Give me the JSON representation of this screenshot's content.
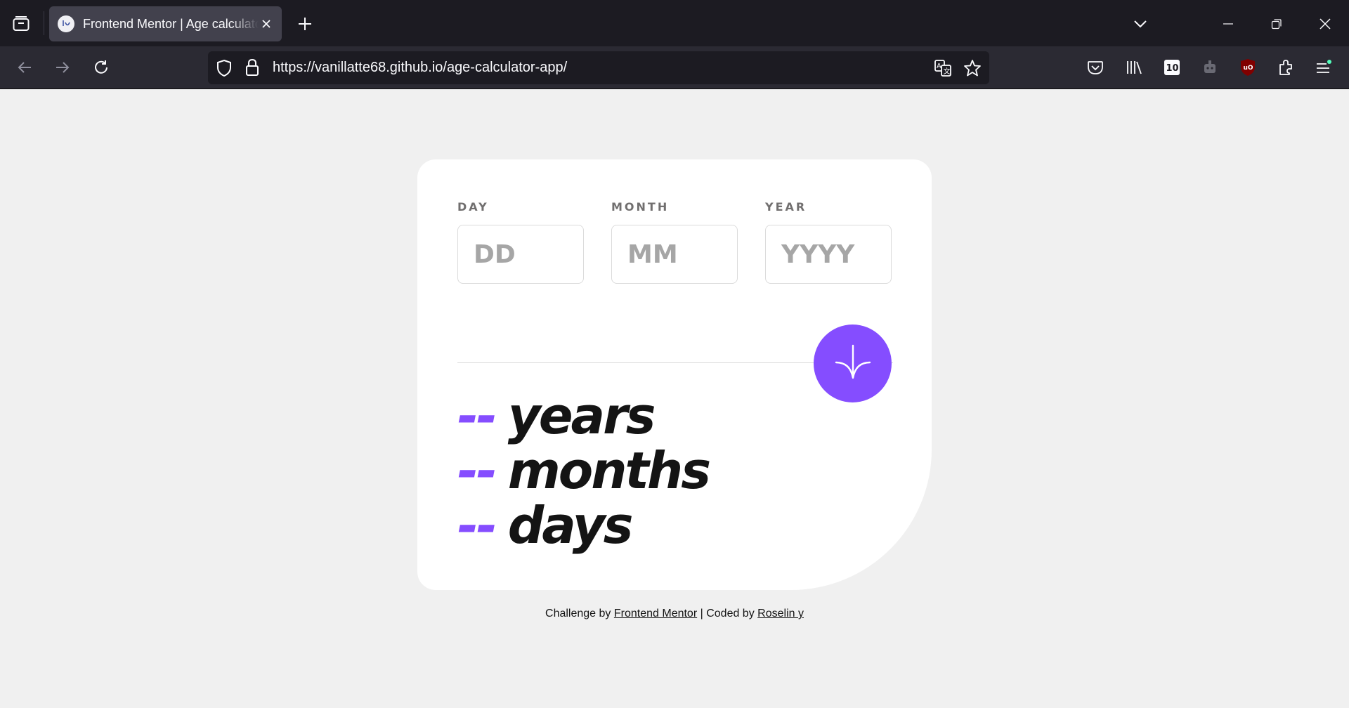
{
  "browser": {
    "tab_title": "Frontend Mentor | Age calculator app",
    "url": "https://vanillatte68.github.io/age-calculator-app/"
  },
  "form": {
    "day": {
      "label": "DAY",
      "placeholder": "DD",
      "value": ""
    },
    "month": {
      "label": "MONTH",
      "placeholder": "MM",
      "value": ""
    },
    "year": {
      "label": "YEAR",
      "placeholder": "YYYY",
      "value": ""
    },
    "submit_icon": "arrow-down-icon"
  },
  "results": [
    {
      "value": "--",
      "unit": "years"
    },
    {
      "value": "--",
      "unit": "months"
    },
    {
      "value": "--",
      "unit": "days"
    }
  ],
  "attribution": {
    "prefix": "Challenge by",
    "frontend_mentor": "Frontend Mentor",
    "middle": "| Coded by",
    "author": "Roselin y"
  },
  "colors": {
    "accent": "#854dff",
    "page_bg": "#f0f0f0",
    "card_bg": "#ffffff",
    "text": "#141414",
    "label": "#716f6f"
  }
}
